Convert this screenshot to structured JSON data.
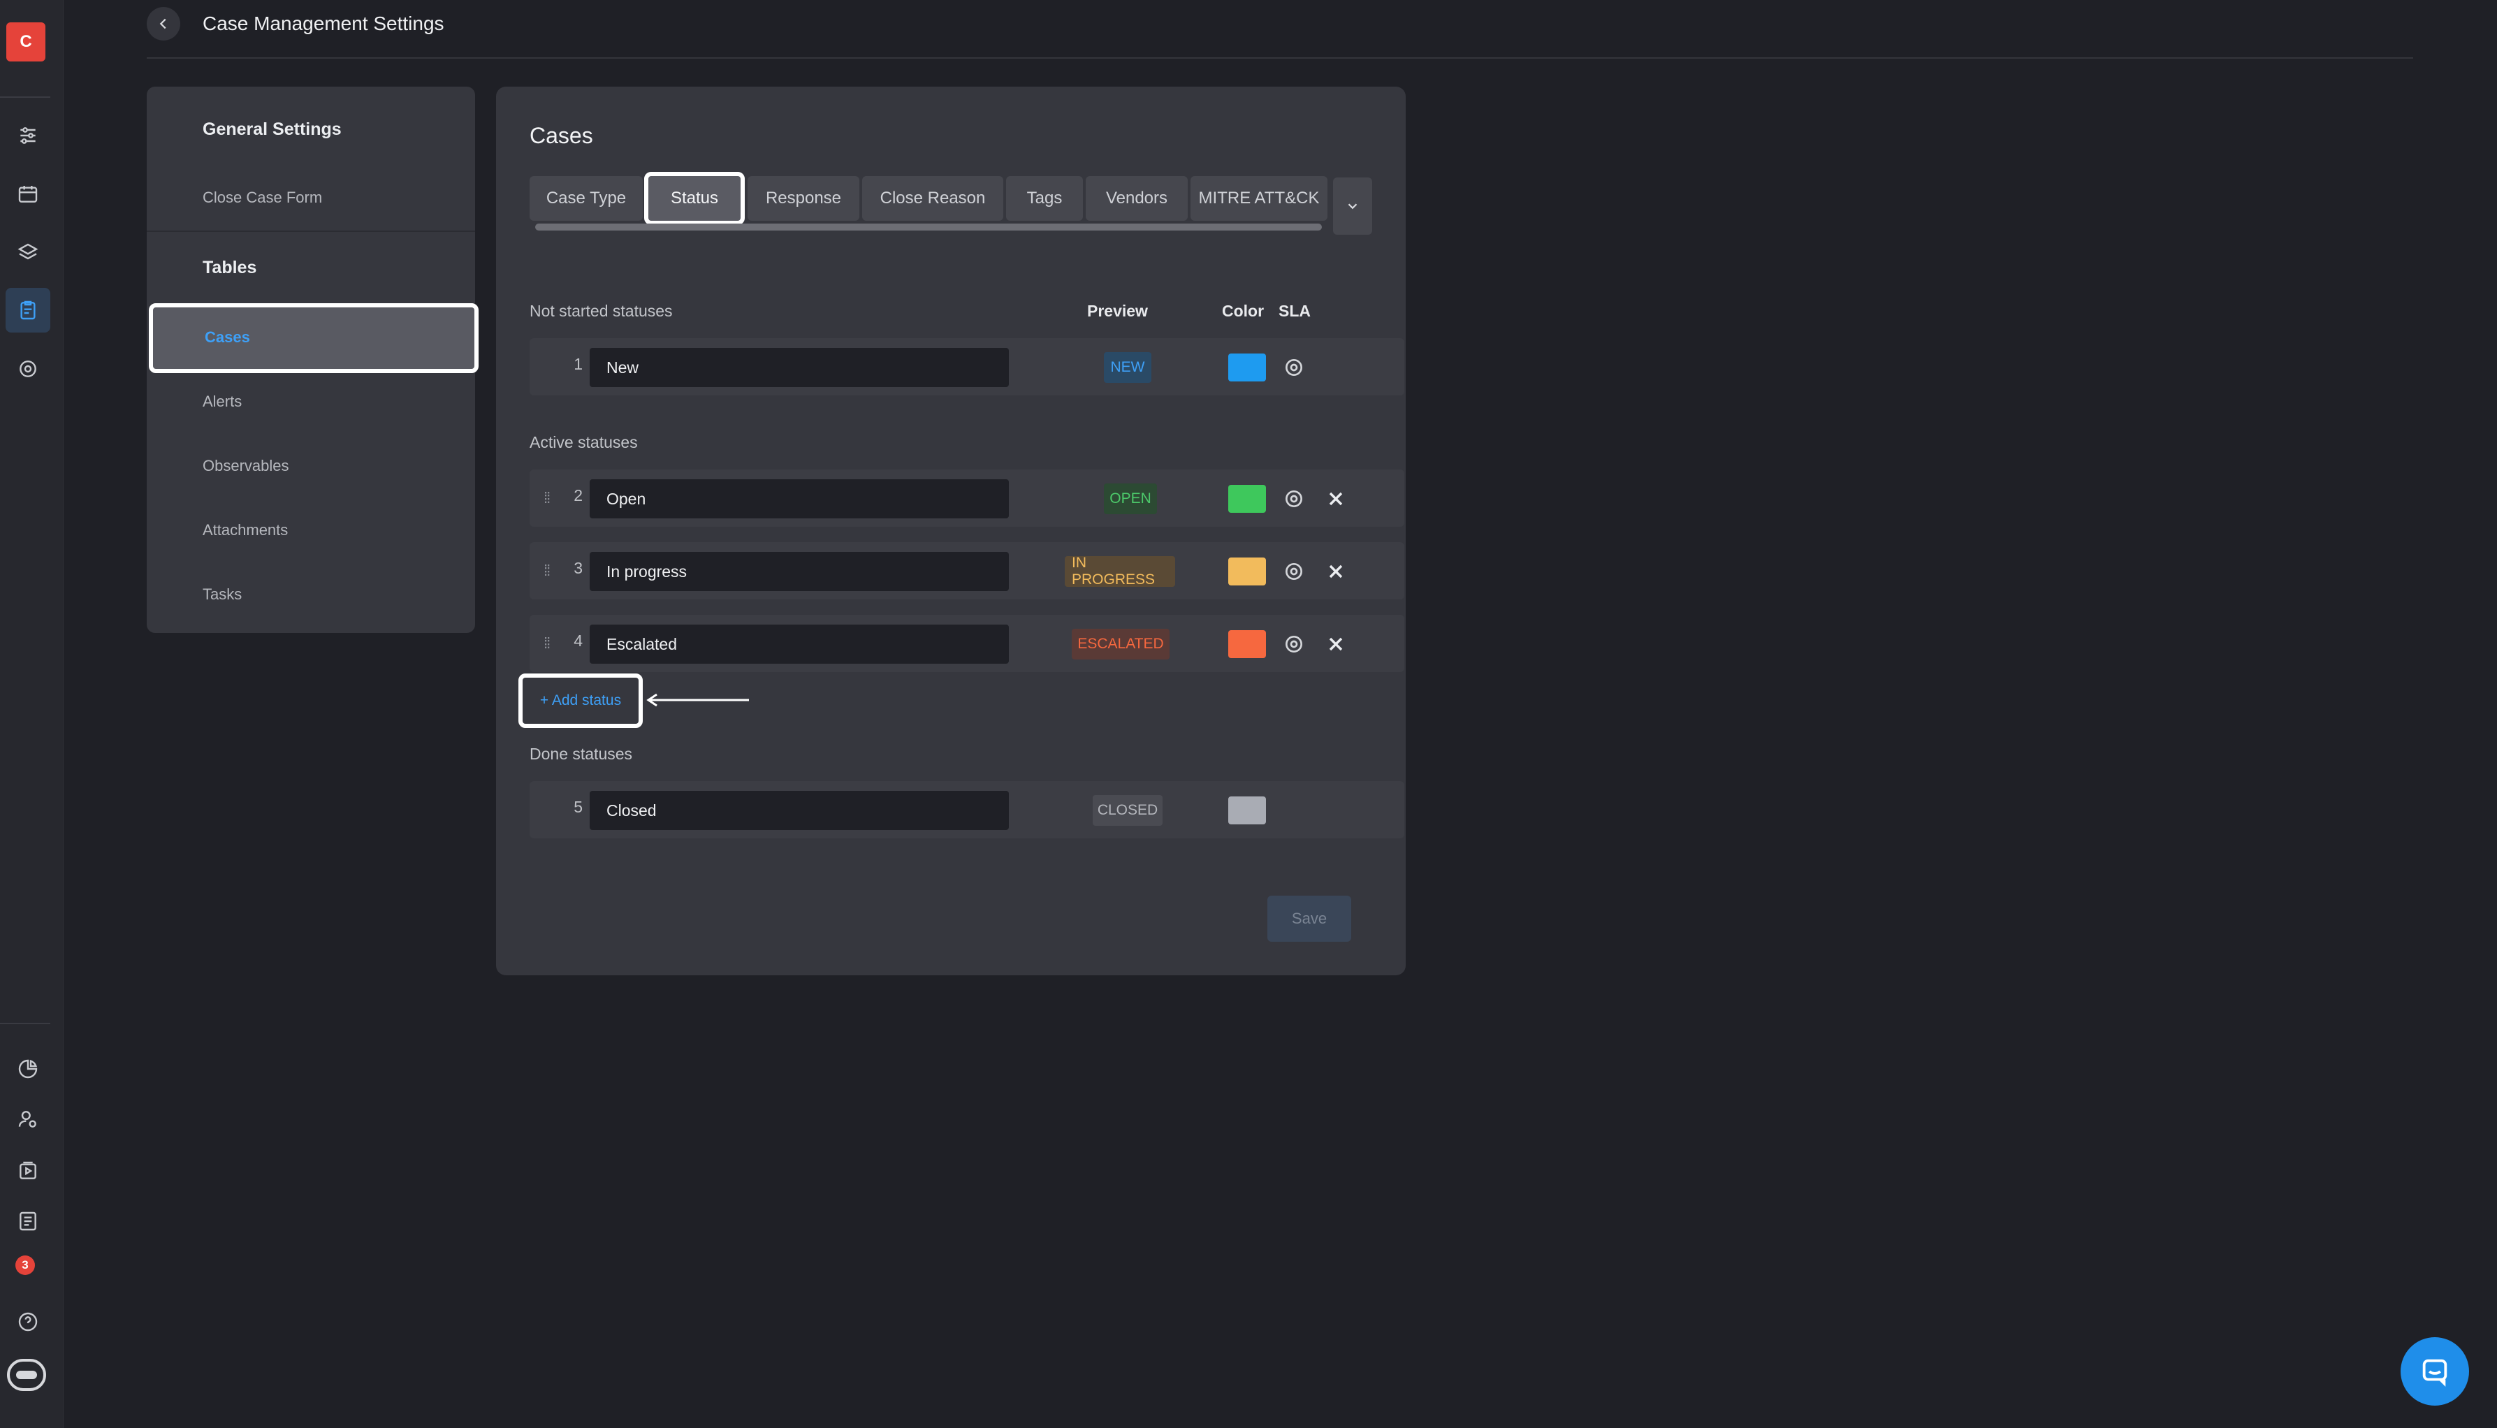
{
  "app": {
    "logo_letter": "C"
  },
  "header": {
    "title": "Case Management Settings"
  },
  "nav": {
    "general_heading": "General Settings",
    "close_case_form": "Close Case Form",
    "tables_heading": "Tables",
    "items": [
      "Cases",
      "Alerts",
      "Observables",
      "Attachments",
      "Tasks"
    ]
  },
  "main": {
    "title": "Cases",
    "tabs": [
      "Case Type",
      "Status",
      "Response",
      "Close Reason",
      "Tags",
      "Vendors",
      "MITRE ATT&CK"
    ],
    "active_tab": "Status",
    "columns": {
      "preview": "Preview",
      "color": "Color",
      "sla": "SLA"
    },
    "sections": {
      "not_started": "Not started statuses",
      "active": "Active statuses",
      "done": "Done statuses"
    },
    "statuses": [
      {
        "num": "1",
        "name": "New",
        "badge": "NEW",
        "color": "#1e9bf0",
        "badge_bg": "#2a4a66",
        "badge_fg": "#3ea0f7"
      },
      {
        "num": "2",
        "name": "Open",
        "badge": "OPEN",
        "color": "#3ec85c",
        "badge_bg": "#2c4a33",
        "badge_fg": "#4cc96a"
      },
      {
        "num": "3",
        "name": "In progress",
        "badge": "IN PROGRESS",
        "color": "#f2bb5c",
        "badge_bg": "#5a4a35",
        "badge_fg": "#f2bb5c"
      },
      {
        "num": "4",
        "name": "Escalated",
        "badge": "ESCALATED",
        "color": "#f6683f",
        "badge_bg": "#5a3a36",
        "badge_fg": "#f6683f"
      },
      {
        "num": "5",
        "name": "Closed",
        "badge": "CLOSED",
        "color": "#a9acb4",
        "badge_bg": "#4a4b52",
        "badge_fg": "#b4b6bc"
      }
    ],
    "add_status": "+ Add status",
    "save": "Save"
  },
  "rail": {
    "notification_count": "3"
  }
}
